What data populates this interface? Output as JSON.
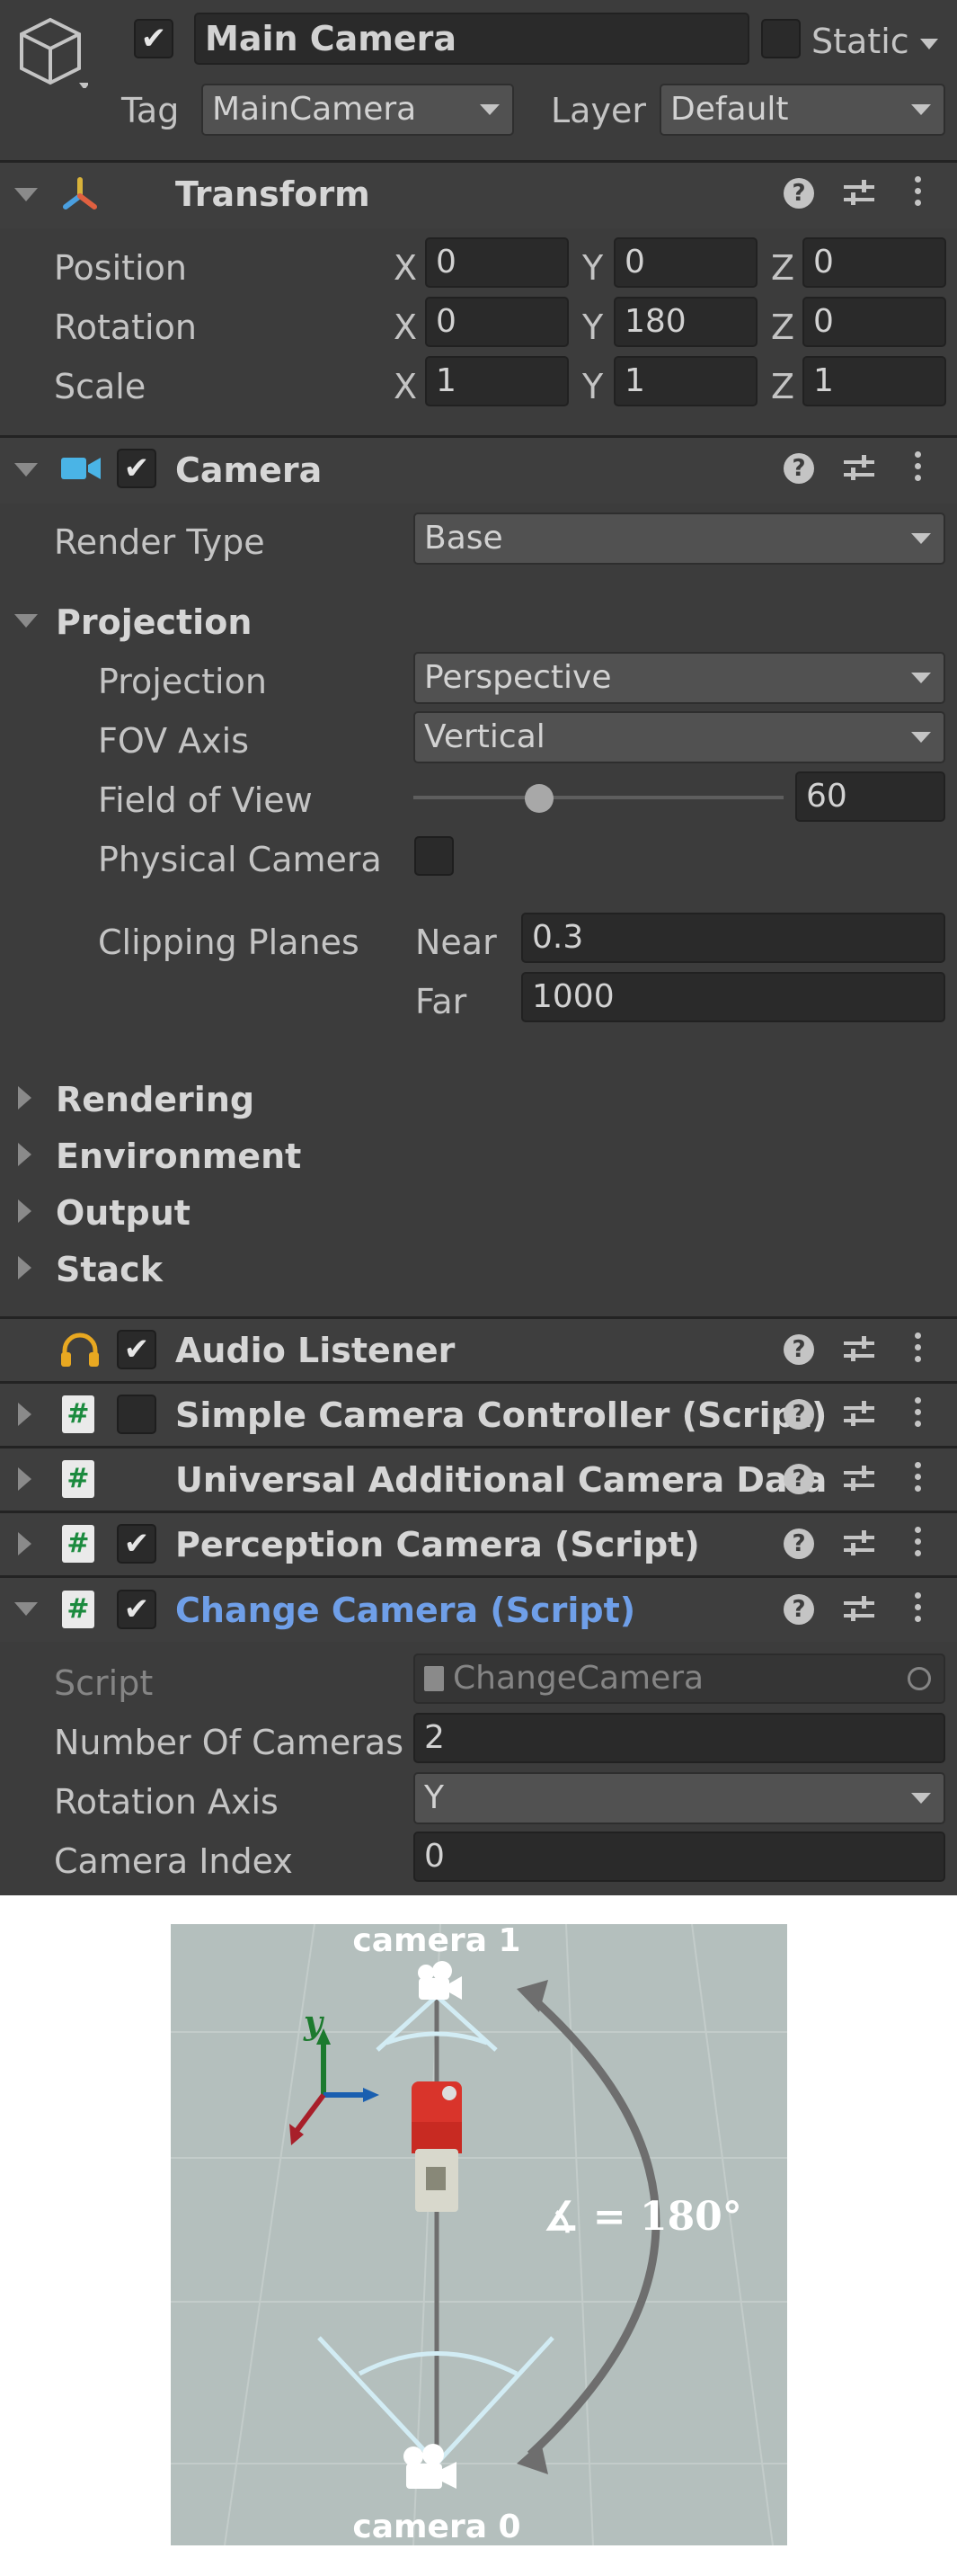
{
  "gameobject": {
    "name": "Main Camera",
    "active_checked": "✔",
    "static_label": "Static",
    "tag_label": "Tag",
    "tag_value": "MainCamera",
    "layer_label": "Layer",
    "layer_value": "Default"
  },
  "transform": {
    "title": "Transform",
    "rows": [
      {
        "label": "Position",
        "x": "0",
        "y": "0",
        "z": "0"
      },
      {
        "label": "Rotation",
        "x": "0",
        "y": "180",
        "z": "0"
      },
      {
        "label": "Scale",
        "x": "1",
        "y": "1",
        "z": "1"
      }
    ],
    "axis_x": "X",
    "axis_y": "Y",
    "axis_z": "Z"
  },
  "camera": {
    "title": "Camera",
    "enabled_mark": "✔",
    "render_type_label": "Render Type",
    "render_type_value": "Base",
    "projection_section": "Projection",
    "projection_label": "Projection",
    "projection_value": "Perspective",
    "fov_axis_label": "FOV Axis",
    "fov_axis_value": "Vertical",
    "fov_label": "Field of View",
    "fov_value": "60",
    "fov_slider_fraction": 0.34,
    "physical_camera_label": "Physical Camera",
    "clipping_label": "Clipping Planes",
    "near_label": "Near",
    "near_value": "0.3",
    "far_label": "Far",
    "far_value": "1000",
    "collapsed_sections": [
      "Rendering",
      "Environment",
      "Output",
      "Stack"
    ]
  },
  "components": {
    "audio_listener": "Audio Listener",
    "audio_mark": "✔",
    "simple_controller": "Simple Camera Controller (Script)",
    "universal_data": "Universal Additional Camera Data",
    "perception": "Perception Camera (Script)",
    "perception_mark": "✔",
    "change_camera": "Change Camera (Script)",
    "change_camera_mark": "✔"
  },
  "change_camera": {
    "script_label": "Script",
    "script_value": "ChangeCamera",
    "number_label": "Number Of Cameras",
    "number_value": "2",
    "axis_label": "Rotation Axis",
    "axis_value": "Y",
    "index_label": "Camera Index",
    "index_value": "0"
  },
  "diagram": {
    "camera_top": "camera 1",
    "camera_bottom": "camera 0",
    "axis_y": "y",
    "angle": "∡ = 180°"
  },
  "icons": [
    "cube-icon",
    "transform-icon",
    "camera-icon",
    "headphones-icon",
    "script-icon",
    "help-icon",
    "preset-sliders-icon",
    "kebab-menu-icon"
  ],
  "colors": {
    "panel_bg": "#3c3c3c",
    "field_bg": "#2a2a2a",
    "dropdown_bg": "#515151",
    "highlight_title": "#6f9fe8",
    "text": "#c4c4c4"
  }
}
